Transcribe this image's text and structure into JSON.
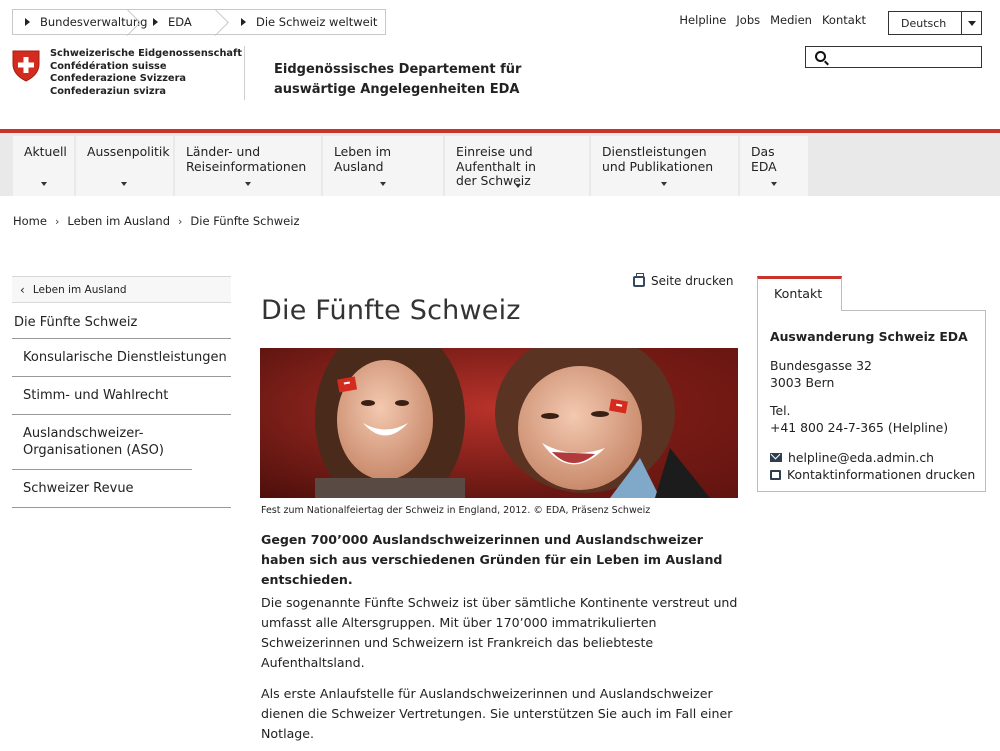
{
  "federal_breadcrumb": [
    "Bundesverwaltung",
    "EDA",
    "Die Schweiz weltweit"
  ],
  "top_links": [
    "Helpline",
    "Jobs",
    "Medien",
    "Kontakt"
  ],
  "language": {
    "selected": "Deutsch"
  },
  "search": {
    "placeholder": ""
  },
  "logo": {
    "confederation": [
      "Schweizerische Eidgenossenschaft",
      "Confédération suisse",
      "Confederazione Svizzera",
      "Confederaziun svizra"
    ],
    "department": [
      "Eidgenössisches Departement für",
      "auswärtige Angelegenheiten EDA"
    ]
  },
  "main_nav": [
    {
      "label": "Aktuell"
    },
    {
      "label": "Aussenpolitik"
    },
    {
      "label": "Länder- und Reiseinformationen"
    },
    {
      "label": "Leben im Ausland"
    },
    {
      "label": "Einreise und Aufenthalt in der Schweiz"
    },
    {
      "label": "Dienstleistungen und Publikationen"
    },
    {
      "label": "Das EDA"
    }
  ],
  "breadcrumb": [
    "Home",
    "Leben im Ausland",
    "Die Fünfte Schweiz"
  ],
  "sidebar": {
    "back_label": "Leben im Ausland",
    "active": "Die Fünfte Schweiz",
    "items": [
      {
        "label": "Konsularische Dienstleistungen"
      },
      {
        "label": "Stimm- und Wahlrecht"
      },
      {
        "label": "Auslandschweizer-Organisationen (ASO)"
      },
      {
        "label": "Schweizer Revue"
      }
    ]
  },
  "content": {
    "print_label": "Seite drucken",
    "title": "Die Fünfte Schweiz",
    "caption": "Fest zum Nationalfeiertag der Schweiz in England, 2012. © EDA, Präsenz Schweiz",
    "lead": "Gegen 700’000 Auslandschweizerinnen und Auslandschweizer haben sich aus verschiedenen Gründen für ein Leben im Ausland entschieden.",
    "paragraphs": [
      "Die sogenannte Fünfte Schweiz ist über sämtliche Kontinente verstreut und umfasst alle Altersgruppen. Mit über 170’000 immatrikulierten Schweizerinnen und Schweizern ist Frankreich das beliebteste Aufenthaltsland.",
      "Als erste Anlaufstelle für Auslandschweizerinnen und Auslandschweizer dienen die Schweizer Vertretungen. Sie unterstützen Sie auch im Fall einer Notlage."
    ]
  },
  "contact": {
    "tab": "Kontakt",
    "org": "Auswanderung Schweiz EDA",
    "street": "Bundesgasse 32",
    "city": "3003 Bern",
    "tel_label": "Tel.",
    "tel": "+41 800 24-7-365 (Helpline)",
    "email": "helpline@eda.admin.ch",
    "print_contact": "Kontaktinformationen drucken"
  },
  "colors": {
    "accent": "#c8342a",
    "nav_bg": "#e9e9e9"
  }
}
